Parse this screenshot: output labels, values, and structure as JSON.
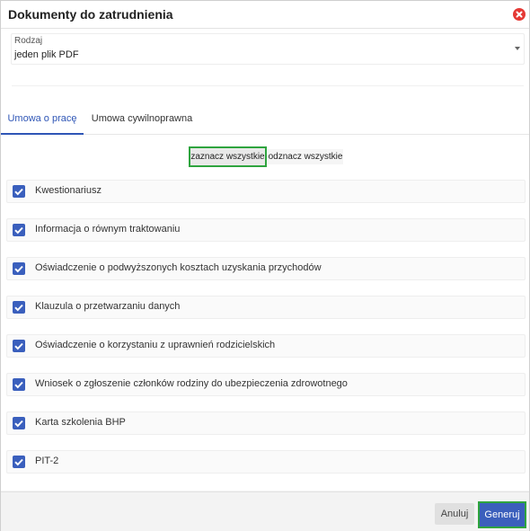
{
  "dialog": {
    "title": "Dokumenty do zatrudnienia"
  },
  "rodzaj": {
    "label": "Rodzaj",
    "value": "jeden plik PDF"
  },
  "tabs": [
    {
      "label": "Umowa o pracę",
      "active": true
    },
    {
      "label": "Umowa cywilnoprawna",
      "active": false
    }
  ],
  "toggle": {
    "select_all": "zaznacz wszystkie",
    "deselect_all": "odznacz wszystkie"
  },
  "documents": [
    {
      "label": "Kwestionariusz",
      "checked": true
    },
    {
      "label": "Informacja o równym traktowaniu",
      "checked": true
    },
    {
      "label": "Oświadczenie o podwyższonych kosztach uzyskania przychodów",
      "checked": true
    },
    {
      "label": "Klauzula o przetwarzaniu danych",
      "checked": true
    },
    {
      "label": "Oświadczenie o korzystaniu z uprawnień rodzicielskich",
      "checked": true
    },
    {
      "label": "Wniosek o zgłoszenie członków rodziny do ubezpieczenia zdrowotnego",
      "checked": true
    },
    {
      "label": "Karta szkolenia BHP",
      "checked": true
    },
    {
      "label": "PIT-2",
      "checked": true
    }
  ],
  "footer": {
    "cancel_label": "Anuluj",
    "generate_label": "Generuj"
  },
  "colors": {
    "accent": "#3b5fbc",
    "highlight": "#2ea43e",
    "close": "#e53935"
  },
  "icons": {
    "close": "close-icon",
    "check": "check-icon",
    "caret": "chevron-down-icon"
  }
}
